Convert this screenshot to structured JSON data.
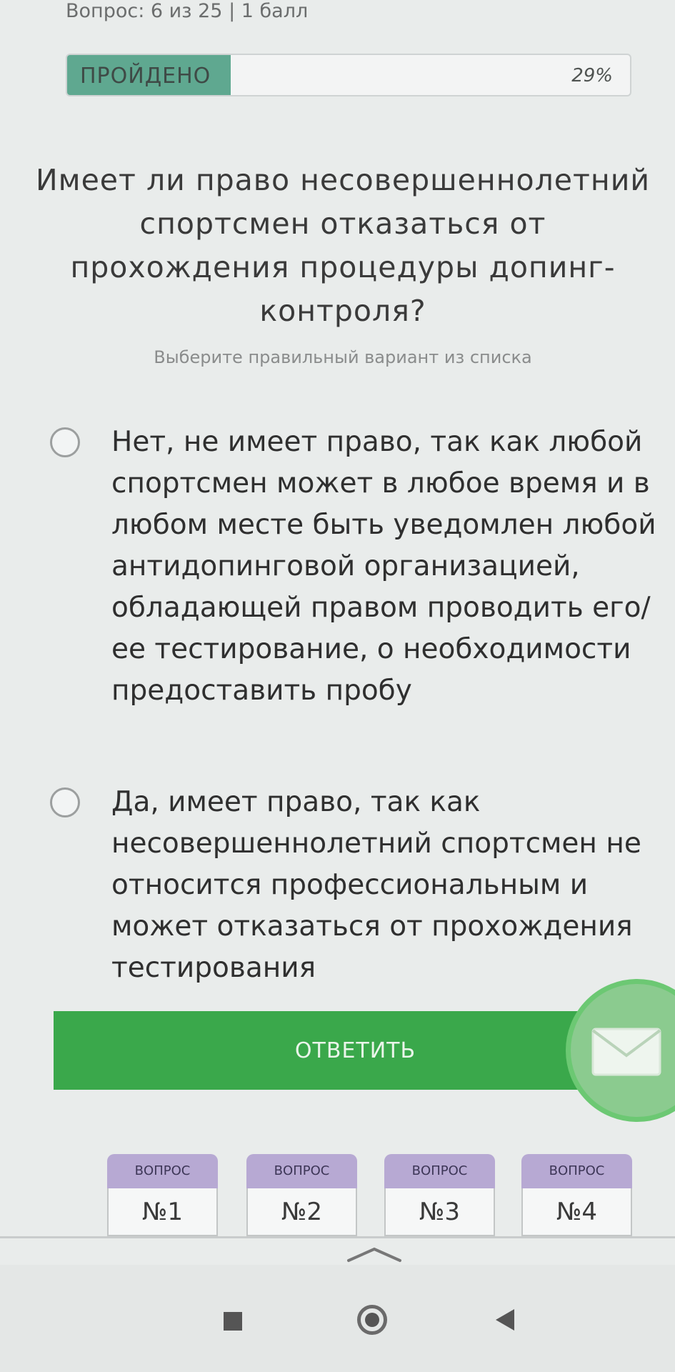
{
  "header": {
    "counter": "Вопрос: 6 из 25 | 1 балл",
    "progress_label": "ПРОЙДЕНО",
    "progress_percent_text": "29%",
    "progress_fraction": 0.29
  },
  "question": {
    "text": "Имеет ли право несовершеннолетний спортсмен отказаться от прохождения процедуры допинг-контроля?",
    "hint": "Выберите правильный вариант из списка"
  },
  "options": [
    {
      "text": "Нет, не имеет право, так как любой спортсмен может в любое время и в любом месте быть уведомлен любой антидопинговой организацией, обладающей правом проводить его/ее тестирование, о необходимости предоставить пробу"
    },
    {
      "text": "Да, имеет право, так как несовершеннолетний спортсмен не относится профессиональным и может отказаться от прохождения тестирования"
    }
  ],
  "answer_button": {
    "label": "ОТВЕТИТЬ"
  },
  "question_tabs": [
    {
      "top": "ВОПРОС",
      "number": "№1"
    },
    {
      "top": "ВОПРОС",
      "number": "№2"
    },
    {
      "top": "ВОПРОС",
      "number": "№3"
    },
    {
      "top": "ВОПРОС",
      "number": "№4"
    }
  ],
  "colors": {
    "progress_fill": "#5fa890",
    "answer_button": "#3aa84b",
    "tab_header": "#b7a9d3",
    "fab": "#6cc873"
  },
  "icons": {
    "fab": "mail-icon",
    "nav": [
      "recents-icon",
      "home-icon",
      "back-icon"
    ]
  }
}
